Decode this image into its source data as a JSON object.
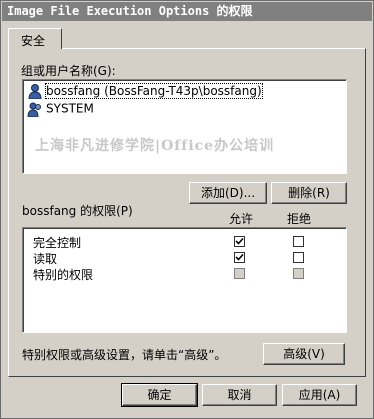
{
  "window": {
    "title": "Image File Execution Options 的权限"
  },
  "tabs": [
    {
      "label": "安全"
    }
  ],
  "users_section": {
    "label": "组或用户名称(G):",
    "users": [
      {
        "name": "bossfang (BossFang-T43p\\bossfang)",
        "selected": true
      },
      {
        "name": "SYSTEM",
        "selected": false
      }
    ],
    "watermark": "上海非凡进修学院|Office办公培训"
  },
  "buttons": {
    "add": "添加(D)...",
    "remove": "删除(R)",
    "advanced": "高级(V)",
    "ok": "确定",
    "cancel": "取消",
    "apply": "应用(A)"
  },
  "permissions": {
    "label": "bossfang 的权限(P)",
    "col_allow": "允许",
    "col_deny": "拒绝",
    "rows": [
      {
        "name": "完全控制",
        "allow": true,
        "deny": false,
        "disabled": false
      },
      {
        "name": "读取",
        "allow": true,
        "deny": false,
        "disabled": false
      },
      {
        "name": "特别的权限",
        "allow": false,
        "deny": false,
        "disabled": true
      }
    ]
  },
  "advanced_note": "特别权限或高级设置，请单击“高级”。"
}
